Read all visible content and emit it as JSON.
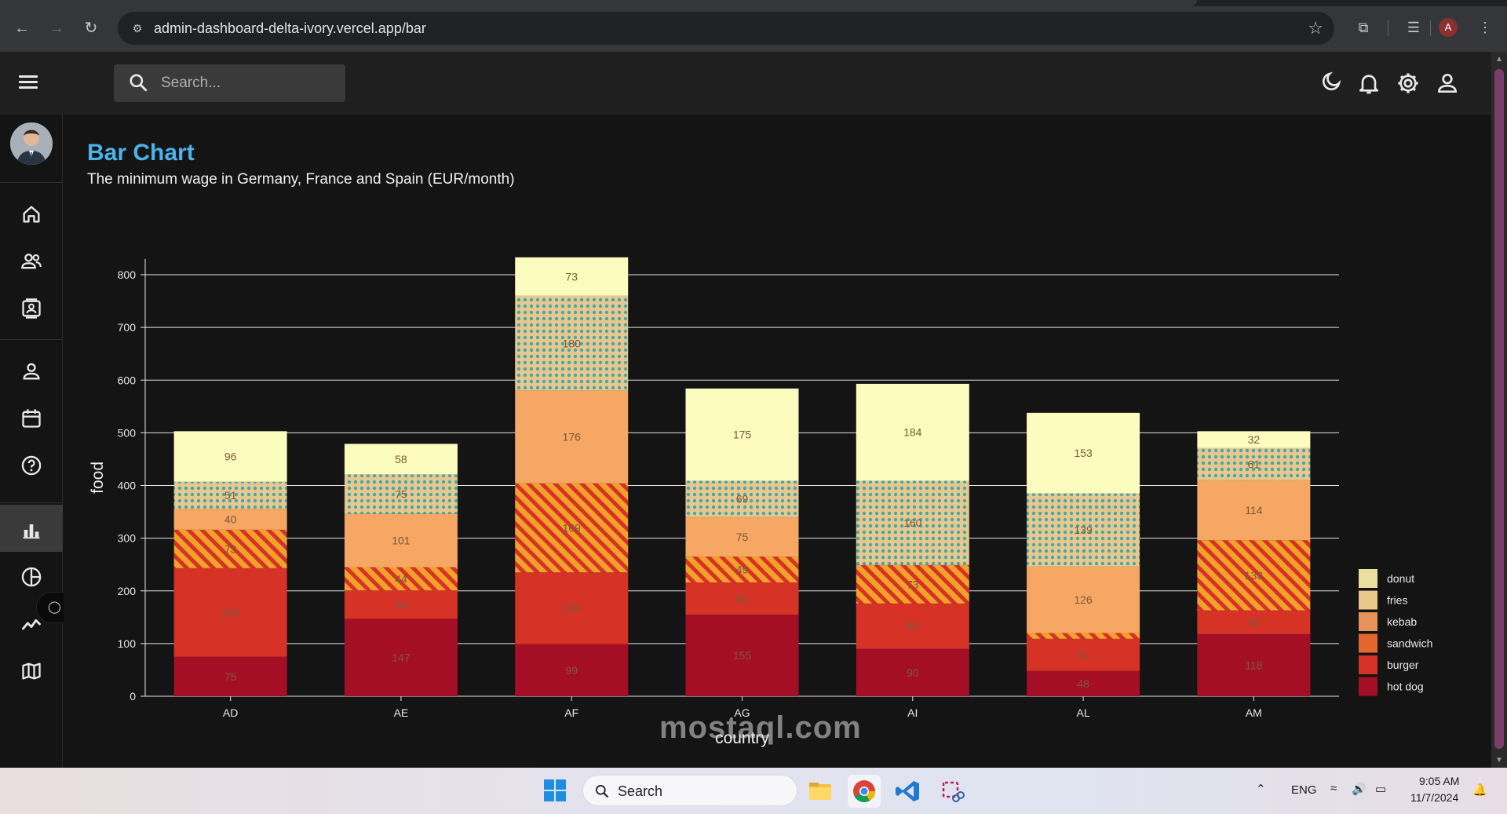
{
  "browser": {
    "url": "admin-dashboard-delta-ivory.vercel.app/bar",
    "profile_initial": "A"
  },
  "topbar": {
    "search_placeholder": "Search..."
  },
  "page": {
    "title": "Bar Chart",
    "subtitle": "The minimum wage in Germany, France and Spain (EUR/month)"
  },
  "colors": {
    "title_accent": "#4ab3ea",
    "hot_dog": "#a50f26",
    "burger": "#d63226",
    "sandwich": "#f2a22a",
    "kebab": "#f5a763",
    "fries": "#e9c890",
    "donut": "#fdfcbf",
    "dots": "#46a9a5",
    "stripes": "#d63226"
  },
  "chart_data": {
    "type": "bar",
    "stacked": true,
    "xlabel": "country",
    "ylabel": "food",
    "ylim": [
      0,
      830
    ],
    "yticks": [
      "0",
      "100",
      "200",
      "300",
      "400",
      "500",
      "600",
      "700",
      "800"
    ],
    "grid": "horizontal",
    "legend_position": "right",
    "categories": [
      "AD",
      "AE",
      "AF",
      "AG",
      "AI",
      "AL",
      "AM"
    ],
    "series": [
      {
        "name": "hot dog",
        "values": [
          75,
          147,
          99,
          155,
          90,
          48,
          118
        ]
      },
      {
        "name": "burger",
        "values": [
          168,
          54,
          136,
          61,
          86,
          61,
          45
        ]
      },
      {
        "name": "sandwich",
        "values": [
          73,
          44,
          169,
          49,
          73,
          11,
          133
        ]
      },
      {
        "name": "kebab",
        "values": [
          40,
          101,
          176,
          75,
          0,
          126,
          114
        ]
      },
      {
        "name": "fries",
        "values": [
          51,
          75,
          180,
          69,
          160,
          139,
          61
        ]
      },
      {
        "name": "donut",
        "values": [
          96,
          58,
          73,
          175,
          184,
          153,
          32
        ]
      }
    ],
    "legend": [
      "donut",
      "fries",
      "kebab",
      "sandwich",
      "burger",
      "hot dog"
    ]
  },
  "taskbar": {
    "search_label": "Search",
    "lang": "ENG",
    "time": "9:05 AM",
    "date": "11/7/2024"
  }
}
